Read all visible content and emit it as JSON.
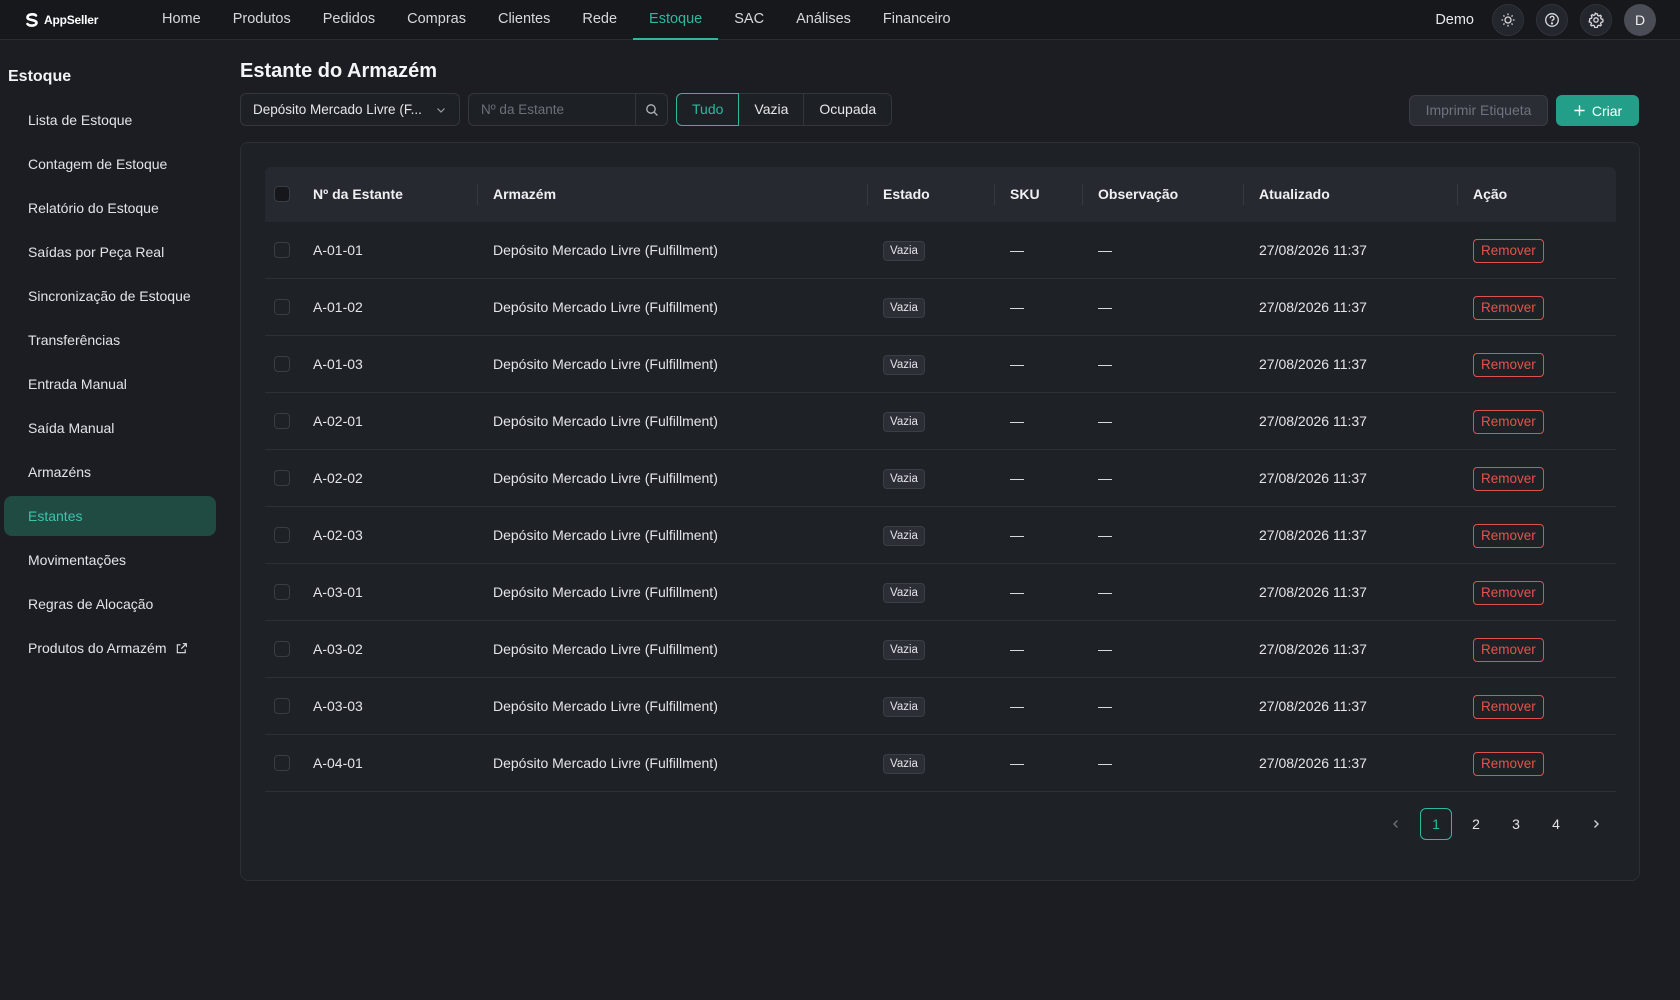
{
  "brand": {
    "name": "AppSeller"
  },
  "nav": {
    "items": [
      {
        "label": "Home"
      },
      {
        "label": "Produtos"
      },
      {
        "label": "Pedidos"
      },
      {
        "label": "Compras"
      },
      {
        "label": "Clientes"
      },
      {
        "label": "Rede"
      },
      {
        "label": "Estoque",
        "active": true
      },
      {
        "label": "SAC"
      },
      {
        "label": "Análises"
      },
      {
        "label": "Financeiro"
      }
    ],
    "user_name": "Demo",
    "avatar_initial": "D",
    "icons": [
      "sun-icon",
      "help-icon",
      "gear-icon"
    ]
  },
  "sidebar": {
    "title": "Estoque",
    "items": [
      {
        "label": "Lista de Estoque"
      },
      {
        "label": "Contagem de Estoque"
      },
      {
        "label": "Relatório do Estoque"
      },
      {
        "label": "Saídas por Peça Real"
      },
      {
        "label": "Sincronização de Estoque"
      },
      {
        "label": "Transferências"
      },
      {
        "label": "Entrada Manual"
      },
      {
        "label": "Saída Manual"
      },
      {
        "label": "Armazéns"
      },
      {
        "label": "Estantes",
        "active": true
      },
      {
        "label": "Movimentações"
      },
      {
        "label": "Regras de Alocação"
      },
      {
        "label": "Produtos do Armazém",
        "external": true
      }
    ]
  },
  "page": {
    "title": "Estante do Armazém",
    "warehouse_select": "Depósito Mercado Livre (F...",
    "search_placeholder": "Nº da Estante",
    "segments": [
      "Tudo",
      "Vazia",
      "Ocupada"
    ],
    "active_segment": "Tudo",
    "print_label_button": "Imprimir Etiqueta",
    "create_button": "Criar"
  },
  "table": {
    "columns": [
      "Nº da Estante",
      "Armazém",
      "Estado",
      "SKU",
      "Observação",
      "Atualizado",
      "Ação"
    ],
    "rows": [
      {
        "shelf": "A-01-01",
        "warehouse": "Depósito Mercado Livre (Fulfillment)",
        "status": "Vazia",
        "sku": "—",
        "note": "—",
        "updated": "27/08/2026 11:37",
        "action": "Remover"
      },
      {
        "shelf": "A-01-02",
        "warehouse": "Depósito Mercado Livre (Fulfillment)",
        "status": "Vazia",
        "sku": "—",
        "note": "—",
        "updated": "27/08/2026 11:37",
        "action": "Remover"
      },
      {
        "shelf": "A-01-03",
        "warehouse": "Depósito Mercado Livre (Fulfillment)",
        "status": "Vazia",
        "sku": "—",
        "note": "—",
        "updated": "27/08/2026 11:37",
        "action": "Remover"
      },
      {
        "shelf": "A-02-01",
        "warehouse": "Depósito Mercado Livre (Fulfillment)",
        "status": "Vazia",
        "sku": "—",
        "note": "—",
        "updated": "27/08/2026 11:37",
        "action": "Remover"
      },
      {
        "shelf": "A-02-02",
        "warehouse": "Depósito Mercado Livre (Fulfillment)",
        "status": "Vazia",
        "sku": "—",
        "note": "—",
        "updated": "27/08/2026 11:37",
        "action": "Remover"
      },
      {
        "shelf": "A-02-03",
        "warehouse": "Depósito Mercado Livre (Fulfillment)",
        "status": "Vazia",
        "sku": "—",
        "note": "—",
        "updated": "27/08/2026 11:37",
        "action": "Remover"
      },
      {
        "shelf": "A-03-01",
        "warehouse": "Depósito Mercado Livre (Fulfillment)",
        "status": "Vazia",
        "sku": "—",
        "note": "—",
        "updated": "27/08/2026 11:37",
        "action": "Remover"
      },
      {
        "shelf": "A-03-02",
        "warehouse": "Depósito Mercado Livre (Fulfillment)",
        "status": "Vazia",
        "sku": "—",
        "note": "—",
        "updated": "27/08/2026 11:37",
        "action": "Remover"
      },
      {
        "shelf": "A-03-03",
        "warehouse": "Depósito Mercado Livre (Fulfillment)",
        "status": "Vazia",
        "sku": "—",
        "note": "—",
        "updated": "27/08/2026 11:37",
        "action": "Remover"
      },
      {
        "shelf": "A-04-01",
        "warehouse": "Depósito Mercado Livre (Fulfillment)",
        "status": "Vazia",
        "sku": "—",
        "note": "—",
        "updated": "27/08/2026 11:37",
        "action": "Remover"
      }
    ]
  },
  "pagination": {
    "pages": [
      "1",
      "2",
      "3",
      "4"
    ],
    "current": "1"
  },
  "colors": {
    "accent": "#2eb8a0",
    "danger": "#e5534b",
    "background": "#1b1d22"
  }
}
